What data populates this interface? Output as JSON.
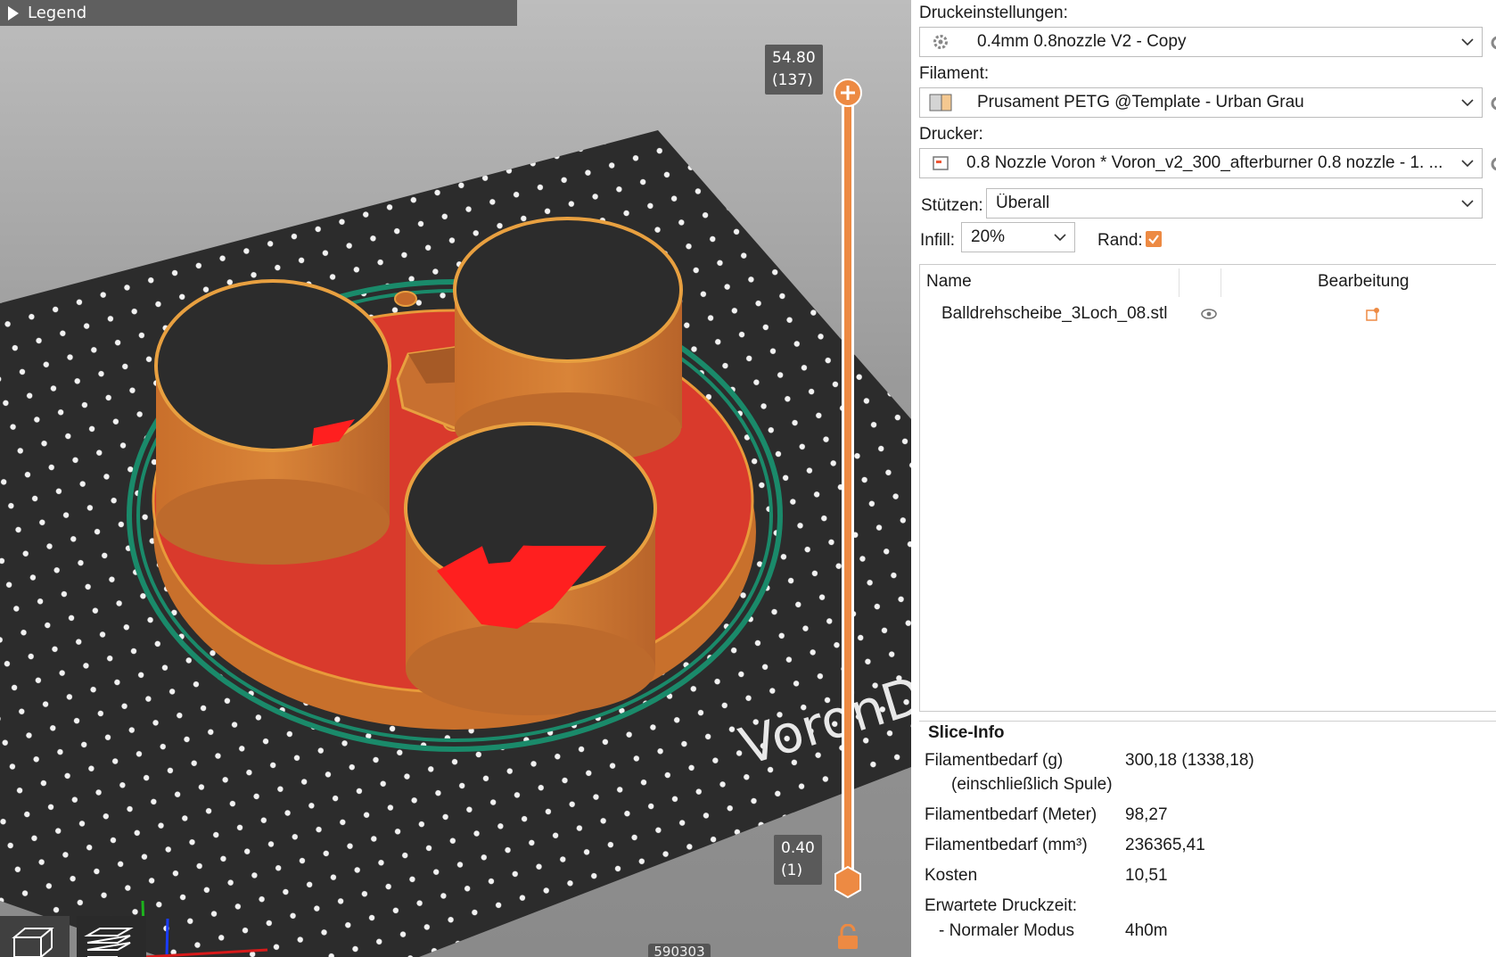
{
  "viewport": {
    "legend_label": "Legend",
    "layer_top": {
      "height": "54.80",
      "layer": "(137)"
    },
    "layer_bottom": {
      "height": "0.40",
      "layer": "(1)"
    },
    "bed_text": "VoronD",
    "count_text": "590303",
    "icons": [
      "play-triangle-icon",
      "3d-view-icon",
      "layers-view-icon",
      "lock-icon",
      "plus-icon"
    ],
    "colors": {
      "slider": "#ed8a43",
      "perimeter": "#d97a2e",
      "infill": "#d93a2c",
      "skirt": "#1a8a6a",
      "bed": "#2c2c2c"
    }
  },
  "sidebar": {
    "print_settings_label": "Druckeinstellungen:",
    "print_settings_value": "0.4mm 0.8nozzle V2 - Copy",
    "filament_label": "Filament:",
    "filament_value": "Prusament PETG @Template - Urban Grau",
    "printer_label": "Drucker:",
    "printer_value": "0.8 Nozzle Voron  * Voron_v2_300_afterburner 0.8 nozzle - 1. ...",
    "supports_label": "Stützen:",
    "supports_value": "Überall",
    "infill_label": "Infill:",
    "infill_value": "20%",
    "brim_label": "Rand:",
    "brim_checked": true,
    "objects": {
      "col_name": "Name",
      "col_edit": "Bearbeitung",
      "items": [
        {
          "name": "Balldrehscheibe_3Loch_08.stl"
        }
      ]
    },
    "slice_info": {
      "title": "Slice-Info",
      "rows": [
        {
          "label": "Filamentbedarf (g)",
          "value": "300,18 (1338,18)"
        },
        {
          "label": "(einschließlich Spule)",
          "value": ""
        },
        {
          "label": "Filamentbedarf (Meter)",
          "value": "98,27"
        },
        {
          "label": "Filamentbedarf (mm³)",
          "value": "236365,41"
        },
        {
          "label": "Kosten",
          "value": "10,51"
        },
        {
          "label": "Erwartete Druckzeit:",
          "value": ""
        },
        {
          "label": "- Normaler Modus",
          "value": "4h0m"
        }
      ]
    }
  }
}
